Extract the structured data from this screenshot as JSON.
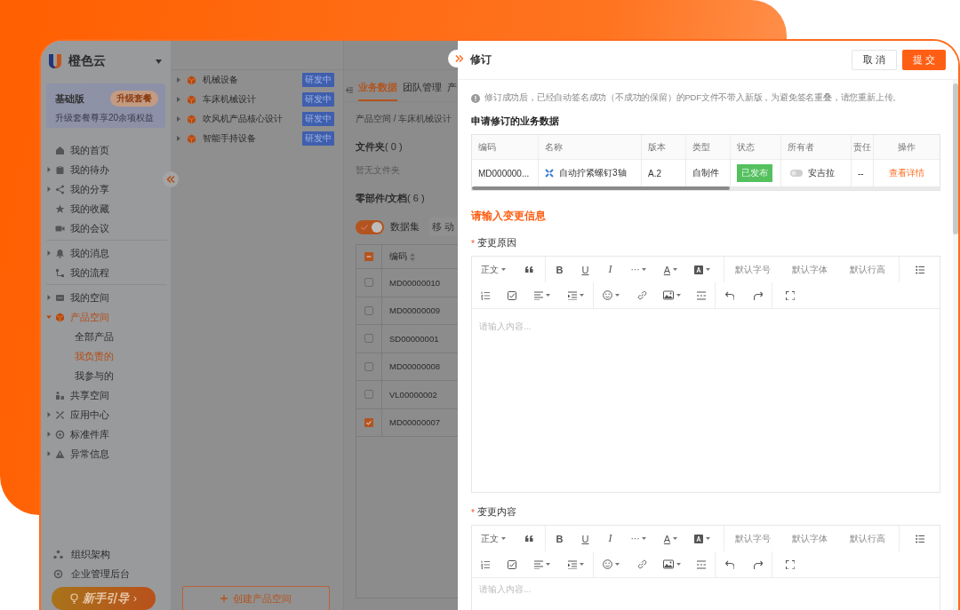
{
  "app": {
    "name": "橙色云"
  },
  "plan": {
    "title": "基础版",
    "upgrade": "升级套餐",
    "note": "升级套餐尊享20余项权益"
  },
  "nav_groups": [
    [
      {
        "label": "我的首页",
        "expandable": false,
        "selected": false
      },
      {
        "label": "我的待办",
        "expandable": true,
        "selected": false
      },
      {
        "label": "我的分享",
        "expandable": true,
        "selected": false
      },
      {
        "label": "我的收藏",
        "expandable": false,
        "selected": false
      },
      {
        "label": "我的会议",
        "expandable": false,
        "selected": false
      }
    ],
    [
      {
        "label": "我的消息",
        "expandable": true,
        "selected": false
      },
      {
        "label": "我的流程",
        "expandable": false,
        "selected": false
      }
    ],
    [
      {
        "label": "我的空间",
        "expandable": true,
        "selected": false
      },
      {
        "label": "产品空间",
        "expandable": true,
        "expanded": true,
        "selected": true,
        "children": [
          {
            "label": "全部产品",
            "selected": false
          },
          {
            "label": "我负责的",
            "selected": true
          },
          {
            "label": "我参与的",
            "selected": false
          }
        ]
      },
      {
        "label": "共享空间",
        "expandable": false,
        "selected": false
      },
      {
        "label": "应用中心",
        "expandable": true,
        "selected": false
      },
      {
        "label": "标准件库",
        "expandable": true,
        "selected": false
      },
      {
        "label": "异常信息",
        "expandable": true,
        "selected": false
      }
    ]
  ],
  "footer_nav": [
    {
      "label": "组织架构"
    },
    {
      "label": "企业管理后台"
    }
  ],
  "guide_button": {
    "label": "新手引导",
    "arrow": "›"
  },
  "products": [
    {
      "name": "机械设备",
      "status": "研发中"
    },
    {
      "name": "车床机械设计",
      "status": "研发中"
    },
    {
      "name": "吹风机产品核心设计",
      "status": "研发中"
    },
    {
      "name": "智能手持设备",
      "status": "研发中"
    }
  ],
  "create_button": "创建产品空间",
  "tabs": [
    {
      "label": "业务数据",
      "selected": true
    },
    {
      "label": "团队管理",
      "selected": false
    },
    {
      "label": "产",
      "selected": false
    }
  ],
  "breadcrumb": "产品空间 / 车床机械设计",
  "folders": {
    "title": "文件夹",
    "count": "( 0 )",
    "empty": "暂无文件夹"
  },
  "parts": {
    "title": "零部件/文档",
    "count": "( 6 )",
    "dataset_toggle": {
      "on": true,
      "label": "数据集"
    },
    "move_button": "移 动",
    "table": {
      "header": "编码",
      "header_indeterminate": true,
      "rows": [
        {
          "code": "MD00000010",
          "checked": false
        },
        {
          "code": "MD00000009",
          "checked": false
        },
        {
          "code": "SD00000001",
          "checked": false
        },
        {
          "code": "MD00000008",
          "checked": false
        },
        {
          "code": "VL00000002",
          "checked": false
        },
        {
          "code": "MD00000007",
          "checked": true
        }
      ]
    }
  },
  "drawer": {
    "title": "修订",
    "cancel": "取 消",
    "submit": "提 交",
    "notice": "修订成功后，已经自动签名成功（不成功的保留）的PDF文件不带入新版，为避免签名重叠，请您重新上传。",
    "section_title": "申请修订的业务数据",
    "columns": [
      "编码",
      "名称",
      "版本",
      "类型",
      "状态",
      "所有者",
      "责任",
      "操作"
    ],
    "rows": [
      {
        "code": "MD000000...",
        "name": "自动拧紧螺钉3轴",
        "version": "A.2",
        "type": "自制件",
        "status": "已发布",
        "owner": "安吉拉",
        "responsible": "--",
        "action": "查看详情"
      }
    ],
    "change_heading": "请输入变更信息",
    "fields": [
      {
        "label": "变更原因",
        "required_mark": "*",
        "placeholder": "请输入内容...",
        "toolbar": {
          "paragraph": "正文",
          "bold": "B",
          "underline": "U",
          "italic": "I",
          "more": "···",
          "font_color": "A",
          "font_size": "默认字号",
          "font_family": "默认字体",
          "line_height": "默认行高"
        }
      },
      {
        "label": "变更内容",
        "required_mark": "*",
        "placeholder": "请输入内容...",
        "toolbar": {
          "paragraph": "正文",
          "bold": "B",
          "underline": "U",
          "italic": "I",
          "more": "···",
          "font_color": "A",
          "font_size": "默认字号",
          "font_family": "默认字体",
          "line_height": "默认行高"
        }
      }
    ]
  }
}
